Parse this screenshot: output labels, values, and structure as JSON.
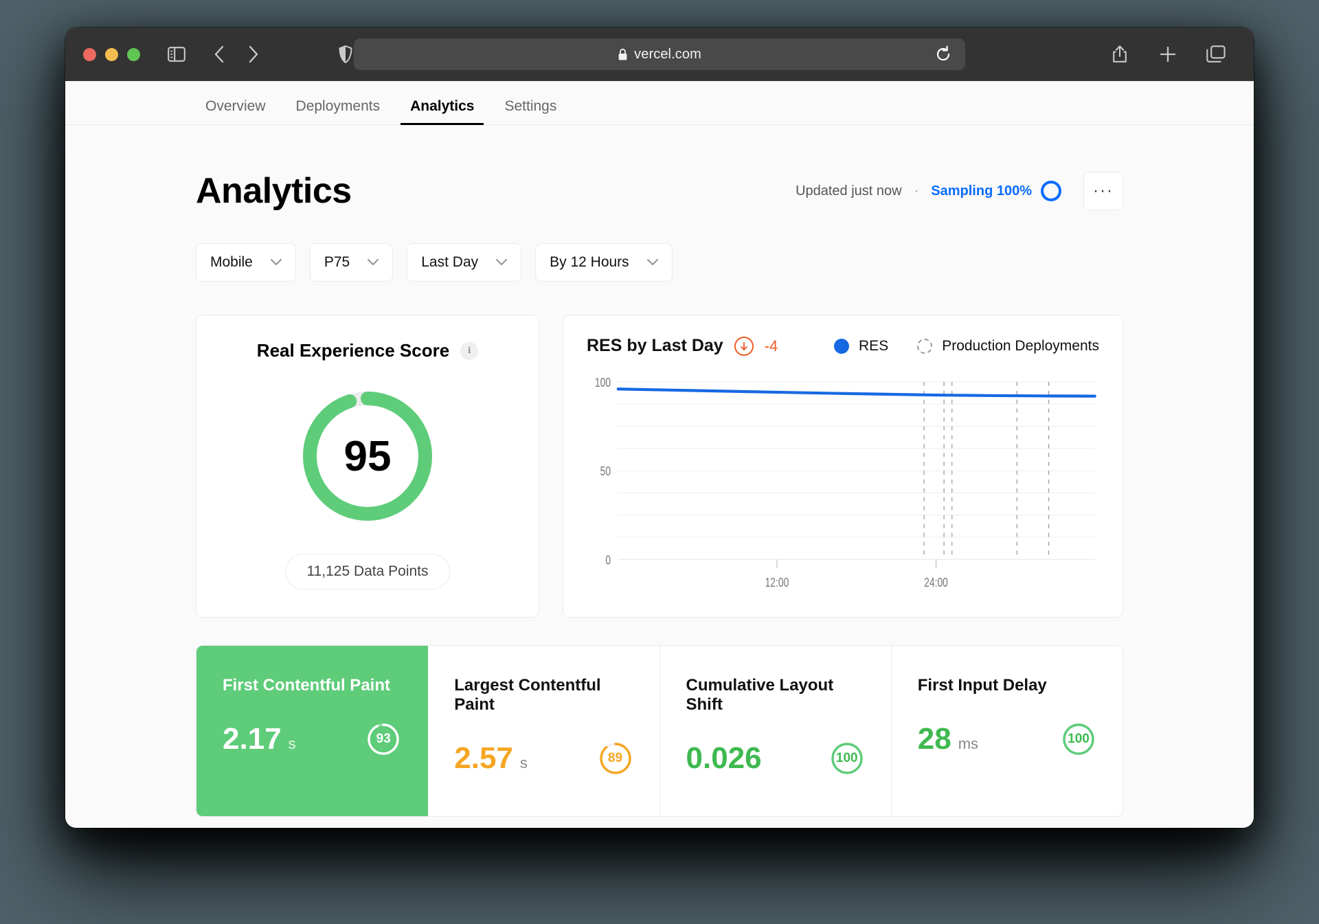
{
  "browser": {
    "url": "vercel.com",
    "lock_icon": "lock-icon",
    "reload_icon": "reload-icon",
    "sidebar_icon": "sidebar-toggle-icon",
    "back_icon": "back-chevron-icon",
    "forward_icon": "forward-chevron-icon",
    "shield_icon": "shield-icon",
    "share_icon": "share-icon",
    "new_tab_icon": "plus-icon",
    "tabs_overview_icon": "tabs-overview-icon",
    "traffic_lights": [
      "close",
      "minimize",
      "maximize"
    ]
  },
  "nav": {
    "tabs": [
      {
        "label": "Overview",
        "active": false
      },
      {
        "label": "Deployments",
        "active": false
      },
      {
        "label": "Analytics",
        "active": true
      },
      {
        "label": "Settings",
        "active": false
      }
    ]
  },
  "header": {
    "title": "Analytics",
    "updated": "Updated just now",
    "separator": "·",
    "sampling": "Sampling 100%",
    "more_label": "···",
    "accent_blue": "#0a6cff"
  },
  "filters": [
    {
      "label": "Mobile"
    },
    {
      "label": "P75"
    },
    {
      "label": "Last Day"
    },
    {
      "label": "By 12 Hours"
    }
  ],
  "res_card": {
    "title": "Real Experience Score",
    "info_glyph": "i",
    "score": "95",
    "score_value": 95,
    "data_points": "11,125 Data Points",
    "ring_color": "#5ecc79",
    "track_color": "#ebebeb"
  },
  "chart_card": {
    "title": "RES by Last Day",
    "delta": "-4",
    "delta_direction": "down",
    "delta_color": "#f05a28",
    "legend": [
      {
        "label": "RES",
        "marker": "solid-blue-dot",
        "color": "#1668e3"
      },
      {
        "label": "Production Deployments",
        "marker": "dashed-circle",
        "color": "#999999"
      }
    ]
  },
  "chart_data": {
    "type": "line",
    "title": "RES by Last Day",
    "xlabel": "",
    "ylabel": "",
    "ylim": [
      0,
      100
    ],
    "yticks": [
      0,
      50,
      100
    ],
    "ytick_labels": [
      "0",
      "50",
      "100"
    ],
    "xlim": [
      0,
      36
    ],
    "xticks": [
      12,
      24
    ],
    "xtick_labels": [
      "12:00",
      "24:00"
    ],
    "grid": true,
    "legend_position": "top-right",
    "series": [
      {
        "name": "RES",
        "color": "#1668e3",
        "x": [
          0,
          4,
          8,
          12,
          16,
          20,
          24,
          28,
          32,
          36
        ],
        "values": [
          96,
          95.4,
          94.8,
          94.2,
          93.6,
          93.1,
          92.6,
          92.3,
          92.1,
          92.0
        ]
      }
    ],
    "annotations": {
      "name": "Production Deployments",
      "style": "dashed-vertical",
      "color": "#999999",
      "x": [
        23.1,
        24.6,
        25.2,
        30.1,
        32.5
      ]
    }
  },
  "metrics": [
    {
      "label": "First Contentful Paint",
      "value": "2.17",
      "unit": "s",
      "score": "93",
      "score_value": 93,
      "active": true,
      "value_color": "#ffffff",
      "card_color": "#5ecc79"
    },
    {
      "label": "Largest Contentful Paint",
      "value": "2.57",
      "unit": "s",
      "score": "89",
      "score_value": 89,
      "active": false,
      "value_color": "#f5a623",
      "card_color": "#ffffff"
    },
    {
      "label": "Cumulative Layout Shift",
      "value": "0.026",
      "unit": "",
      "score": "100",
      "score_value": 100,
      "active": false,
      "value_color": "#3fb950",
      "card_color": "#ffffff"
    },
    {
      "label": "First Input Delay",
      "value": "28",
      "unit": "ms",
      "score": "100",
      "score_value": 100,
      "active": false,
      "value_color": "#3fb950",
      "card_color": "#ffffff"
    }
  ]
}
